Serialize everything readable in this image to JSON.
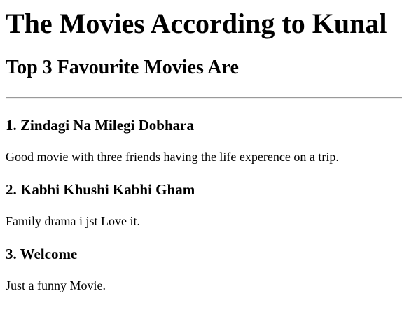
{
  "page": {
    "title": "The Movies According to Kunal",
    "subtitle": "Top 3 Favourite Movies Are"
  },
  "movies": [
    {
      "heading": "1. Zindagi Na Milegi Dobhara",
      "description": "Good movie with three friends having the life experence on a trip."
    },
    {
      "heading": "2. Kabhi Khushi Kabhi Gham",
      "description": "Family drama i jst Love it."
    },
    {
      "heading": "3. Welcome",
      "description": "Just a funny Movie."
    }
  ]
}
